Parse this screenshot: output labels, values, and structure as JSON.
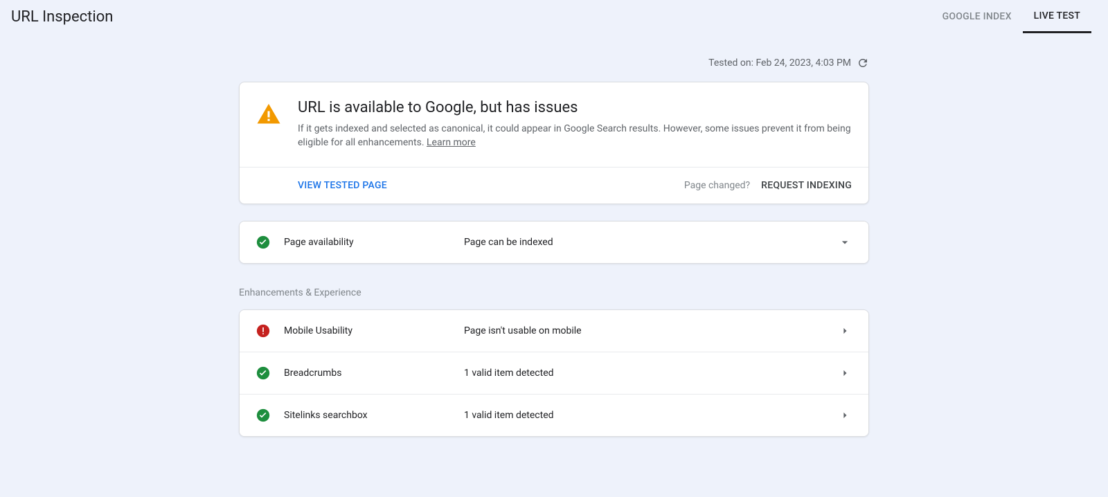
{
  "header": {
    "title": "URL Inspection",
    "tabs": [
      {
        "label": "GOOGLE INDEX",
        "active": false
      },
      {
        "label": "LIVE TEST",
        "active": true
      }
    ]
  },
  "tested_on": {
    "prefix": "Tested on:",
    "value": "Feb 24, 2023, 4:03 PM"
  },
  "status": {
    "title": "URL is available to Google, but has issues",
    "description": "If it gets indexed and selected as canonical, it could appear in Google Search results. However, some issues prevent it from being eligible for all enhancements. ",
    "learn_more": "Learn more",
    "view_tested": "VIEW TESTED PAGE",
    "page_changed": "Page changed?",
    "request_indexing": "REQUEST INDEXING"
  },
  "availability": {
    "label": "Page availability",
    "value": "Page can be indexed",
    "status": "ok"
  },
  "sections": {
    "enhancements_title": "Enhancements & Experience"
  },
  "enhancements": [
    {
      "label": "Mobile Usability",
      "value": "Page isn't usable on mobile",
      "status": "error"
    },
    {
      "label": "Breadcrumbs",
      "value": "1 valid item detected",
      "status": "ok"
    },
    {
      "label": "Sitelinks searchbox",
      "value": "1 valid item detected",
      "status": "ok"
    }
  ],
  "colors": {
    "ok": "#1e8e3e",
    "error": "#c5221f",
    "warning": "#f29900"
  }
}
